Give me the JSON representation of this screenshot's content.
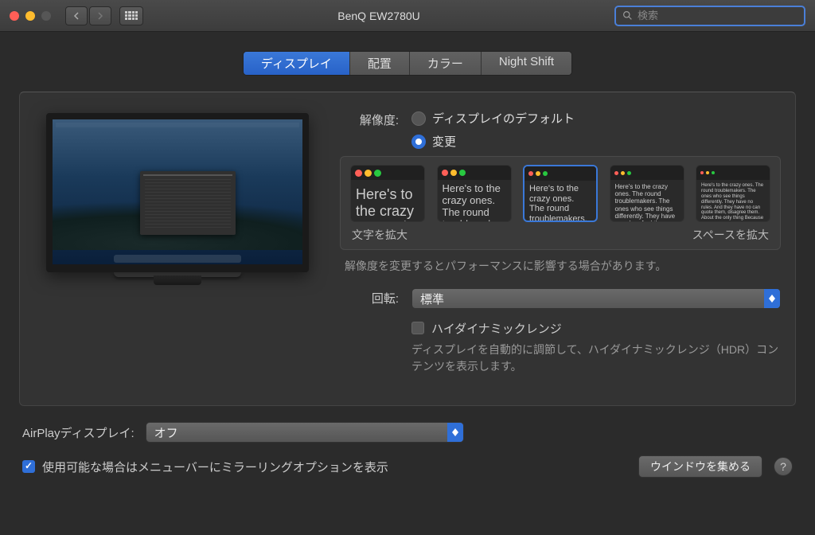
{
  "window": {
    "title": "BenQ EW2780U",
    "search_placeholder": "検索"
  },
  "tabs": {
    "display": "ディスプレイ",
    "arrangement": "配置",
    "color": "カラー",
    "night_shift": "Night Shift"
  },
  "resolution": {
    "label": "解像度:",
    "default_option": "ディスプレイのデフォルト",
    "scaled_option": "変更",
    "larger_text": "文字を拡大",
    "more_space": "スペースを拡大",
    "note": "解像度を変更するとパフォーマンスに影響する場合があります。",
    "sample_text": "Here's to the crazy ones. The round troublemakers. The ones who see things differently. They have no rules. And they have no can quote them, disagree them. About the only thing Because they change things."
  },
  "rotation": {
    "label": "回転:",
    "value": "標準"
  },
  "hdr": {
    "label": "ハイダイナミックレンジ",
    "description": "ディスプレイを自動的に調節して、ハイダイナミックレンジ（HDR）コンテンツを表示します。"
  },
  "airplay": {
    "label": "AirPlayディスプレイ:",
    "value": "オフ"
  },
  "mirroring": {
    "label": "使用可能な場合はメニューバーにミラーリングオプションを表示"
  },
  "gather_button": "ウインドウを集める"
}
